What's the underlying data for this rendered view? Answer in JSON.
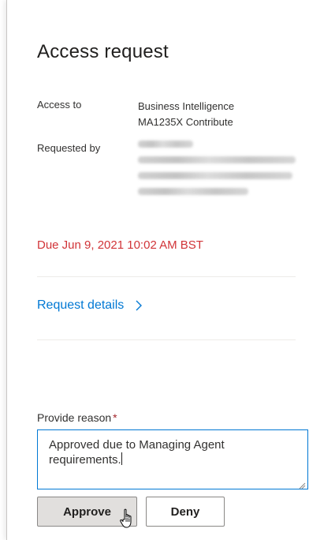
{
  "panel": {
    "title": "Access request",
    "access_to": {
      "label": "Access to",
      "lines": [
        "Business Intelligence",
        "MA1235X Contribute"
      ]
    },
    "requested_by": {
      "label": "Requested by",
      "redacted_line_count": 5
    },
    "due": "Due Jun 9, 2021 10:02 AM BST",
    "details_link": "Request details",
    "reason": {
      "label": "Provide reason",
      "required_marker": "*",
      "value_line1": "Approved due to Managing Agent",
      "value_line2": "requirements."
    },
    "buttons": {
      "approve": "Approve",
      "deny": "Deny"
    }
  },
  "colors": {
    "accent": "#0078d4",
    "due_red": "#d13438",
    "required_red": "#a4262c",
    "approve_bg": "#e1dfdd"
  },
  "icons": [
    "chevron-right-icon",
    "resize-grip-icon",
    "hand-pointer-cursor-icon"
  ]
}
